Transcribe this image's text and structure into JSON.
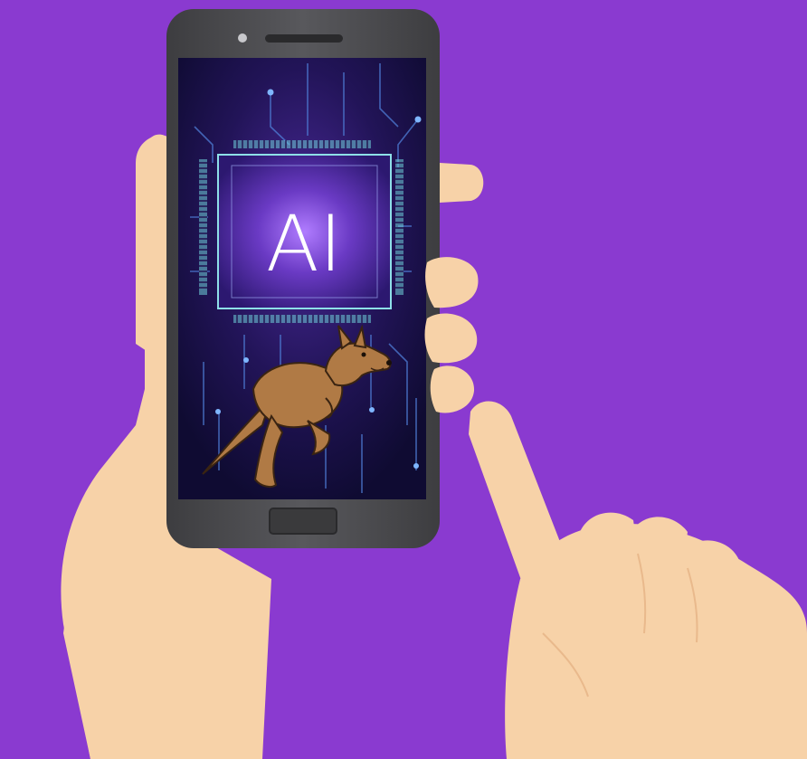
{
  "scene": {
    "background_color": "#8a3ad0",
    "skin_color": "#f7d2a8",
    "phone_body_color": "#4a4a4c",
    "screen_color": "#241650",
    "chip_glow_color": "#7a4bd6",
    "circuit_color": "#5aa0e6",
    "kangaroo_color": "#b07a45"
  },
  "screen": {
    "chip_text": "AI",
    "mascot": "kangaroo-icon"
  },
  "phone": {
    "home_button": "home-button",
    "speaker": "speaker-icon",
    "camera": "camera-icon"
  }
}
